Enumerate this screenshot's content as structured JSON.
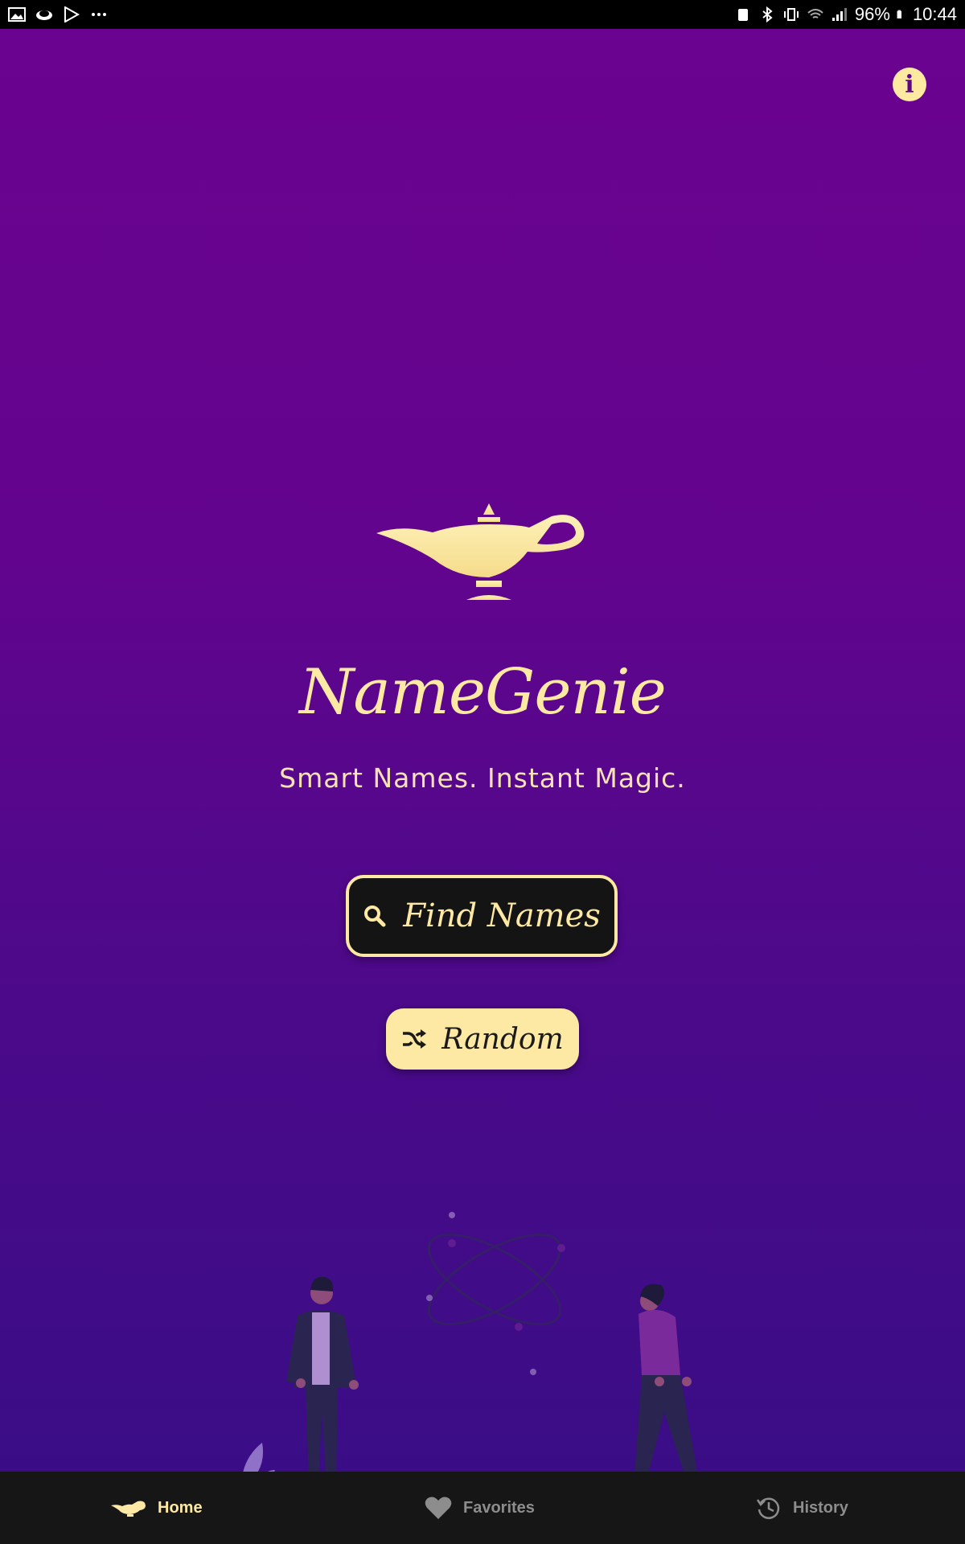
{
  "status_bar": {
    "battery": "96%",
    "time": "10:44",
    "icons": [
      "gallery-icon",
      "cloud-icon",
      "play-store-icon",
      "more-dots-icon",
      "nfc-icon",
      "bluetooth-icon",
      "vibrate-icon",
      "wifi-icon",
      "signal-icon",
      "battery-icon"
    ]
  },
  "app": {
    "title": "NameGenie",
    "tagline": "Smart Names. Instant Magic.",
    "info_icon": "info-icon",
    "logo_icon": "magic-lamp-icon"
  },
  "actions": {
    "find_label": "Find Names",
    "find_icon": "search-icon",
    "random_label": "Random",
    "random_icon": "shuffle-icon"
  },
  "nav": {
    "items": [
      {
        "label": "Home",
        "icon": "lamp-icon",
        "active": true
      },
      {
        "label": "Favorites",
        "icon": "heart-icon",
        "active": false
      },
      {
        "label": "History",
        "icon": "history-icon",
        "active": false
      }
    ]
  },
  "colors": {
    "accent": "#fde9a3",
    "background_top": "#6a038f",
    "background_bottom": "#3a0d86",
    "nav_background": "#161616",
    "inactive": "#8d8d8d"
  }
}
